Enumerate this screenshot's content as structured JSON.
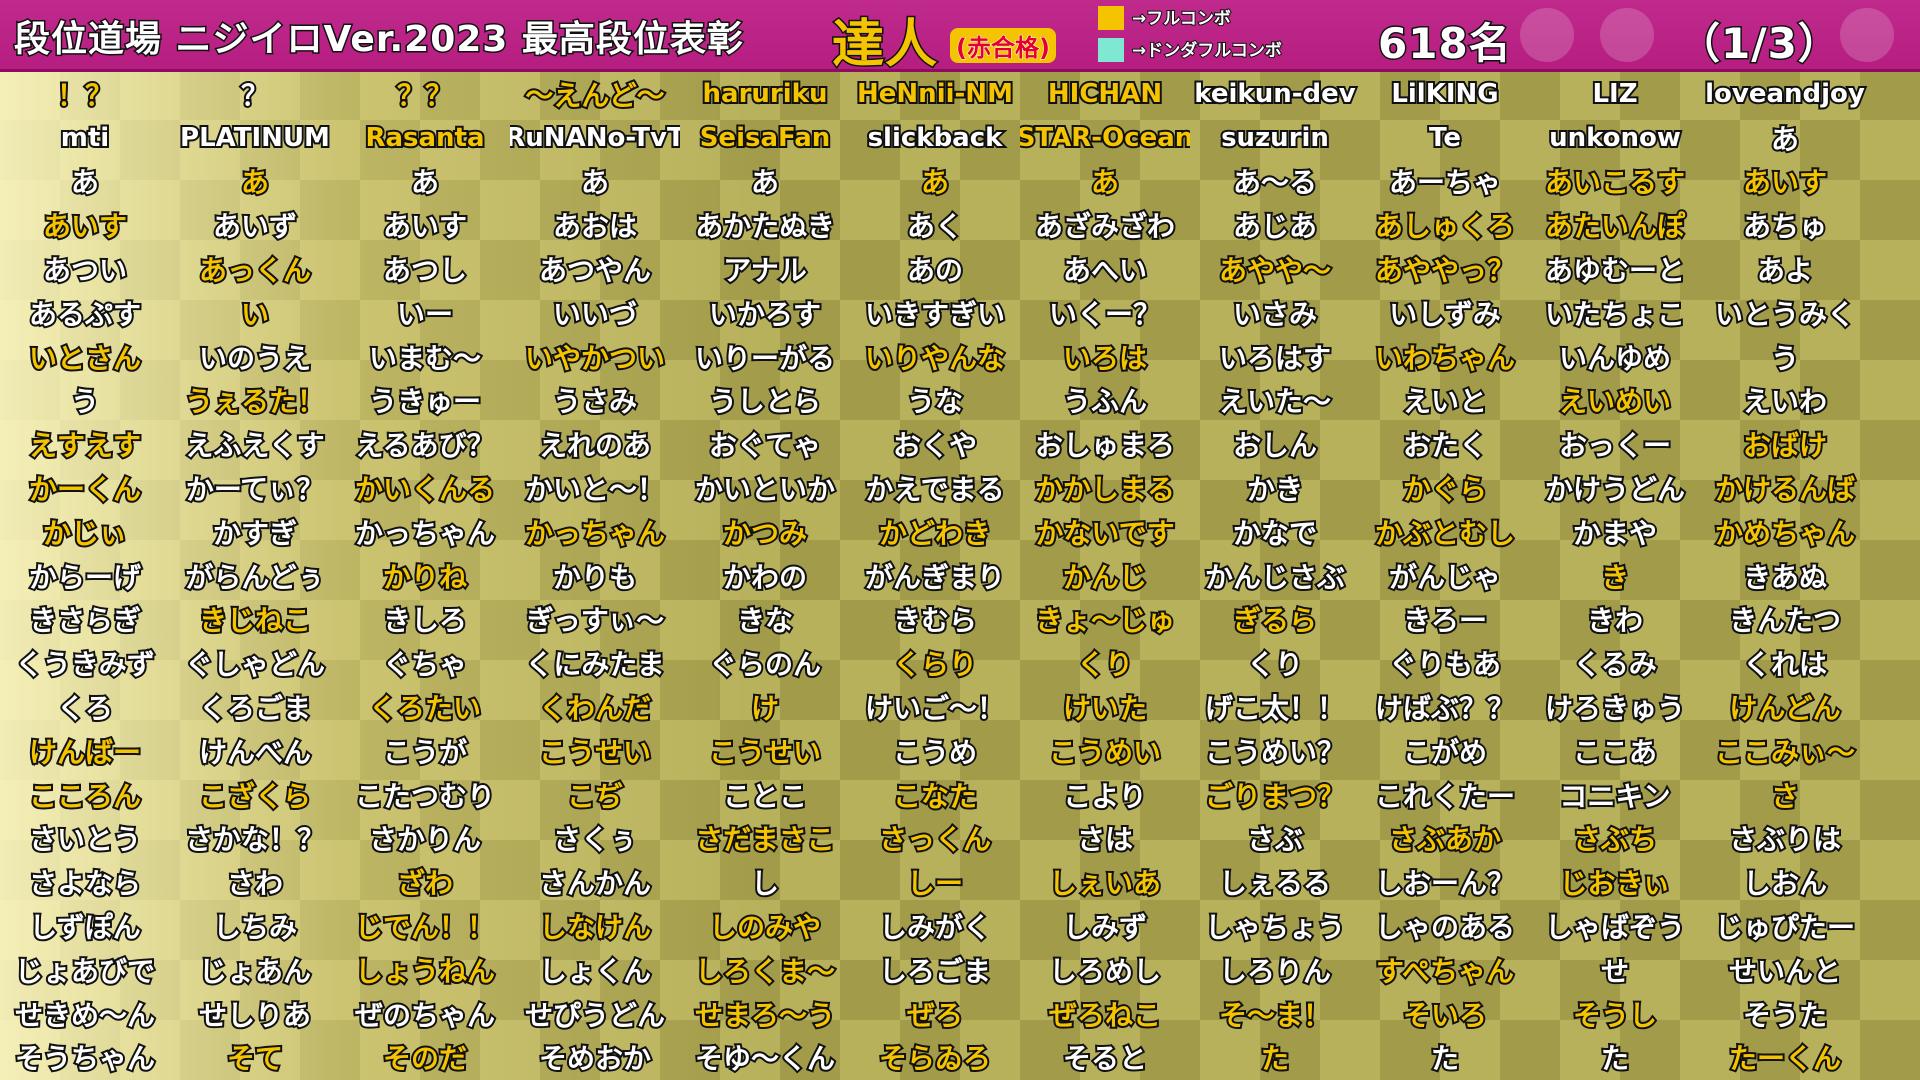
{
  "header": {
    "title": "段位道場 ニジイロVer.2023 最高段位表彰",
    "rank": "達人",
    "rank_note": "(赤合格)",
    "legend": [
      {
        "label": "→フルコンボ",
        "color": "#f5c400"
      },
      {
        "label": "→ドンダフルコンボ",
        "color": "#7ee8d2"
      }
    ],
    "count": "618名",
    "page": "（1/3）"
  },
  "rows": [
    [
      "！？",
      "？",
      "？？",
      "～えんど～",
      "haruriku",
      "HeNnii-NM",
      "HICHAN",
      "keikun-dev",
      "LilKING",
      "LIZ",
      "loveandjoy"
    ],
    [
      "mti",
      "PLATINUM",
      "Rasanta",
      "RuNANo-TvT",
      "SeisaFan",
      "slickback",
      "STAR-Ocean",
      "suzurin",
      "Te",
      "unkonow",
      "あ"
    ],
    [
      "あ",
      "あ",
      "あ",
      "あ",
      "あ",
      "あ",
      "あ",
      "あ～る",
      "あーちゃ",
      "あいこるす",
      "あいす"
    ],
    [
      "あいす",
      "あいず",
      "あいす",
      "あおは",
      "あかたぬき",
      "あく",
      "あざみざわ",
      "あじあ",
      "あしゅくろ",
      "あたいんぽ",
      "あちゅ"
    ],
    [
      "あつい",
      "あっくん",
      "あつし",
      "あつやん",
      "アナル",
      "あの",
      "あへい",
      "あやや～",
      "あややっ？",
      "あゆむーと",
      "あよ"
    ],
    [
      "あるぷす",
      "い",
      "いー",
      "いいづ",
      "いかろす",
      "いきすぎい",
      "いくー？",
      "いさみ",
      "いしずみ",
      "いたちょこ",
      "いとうみく"
    ],
    [
      "いとさん",
      "いのうえ",
      "いまむ～",
      "いやかつい",
      "いりーがる",
      "いりやんな",
      "いろは",
      "いろはす",
      "いわちゃん",
      "いんゆめ",
      "う"
    ],
    [
      "う",
      "うぇるた！",
      "うきゅー",
      "うさみ",
      "うしとら",
      "うな",
      "うふん",
      "えいた～",
      "えいと",
      "えいめい",
      "えいわ"
    ],
    [
      "えすえす",
      "えふえくす",
      "えるあび？",
      "えれのあ",
      "おぐてゃ",
      "おくや",
      "おしゅまろ",
      "おしん",
      "おたく",
      "おっくー",
      "おばけ"
    ],
    [
      "かーくん",
      "かーてぃ？",
      "かいくんる",
      "かいと～！",
      "かいといか",
      "かえでまる",
      "かかしまる",
      "かき",
      "かぐら",
      "かけうどん",
      "かけるんば"
    ],
    [
      "かじぃ",
      "かすぎ",
      "かっちゃん",
      "かっちゃん",
      "かつみ",
      "かどわき",
      "かないです",
      "かなで",
      "かぶとむし",
      "かまや",
      "かめちゃん"
    ],
    [
      "からーげ",
      "がらんどぅ",
      "かりね",
      "かりも",
      "かわの",
      "がんぎまり",
      "かんじ",
      "かんじさぶ",
      "がんじゃ",
      "き",
      "きあぬ"
    ],
    [
      "きさらぎ",
      "きじねこ",
      "きしろ",
      "ぎっすぃ～",
      "きな",
      "きむら",
      "きょ～じゅ",
      "ぎるら",
      "きろー",
      "きわ",
      "きんたつ"
    ],
    [
      "くうきみず",
      "ぐしゃどん",
      "ぐちゃ",
      "くにみたま",
      "ぐらのん",
      "くらり",
      "くり",
      "くり",
      "ぐりもあ",
      "くるみ",
      "くれは"
    ],
    [
      "くろ",
      "くろごま",
      "くろたい",
      "くわんだ",
      "け",
      "けいご～！",
      "けいた",
      "げこ太！！",
      "けばぶ？？",
      "けろきゅう",
      "けんどん"
    ],
    [
      "けんばー",
      "けんべん",
      "こうが",
      "こうせい",
      "こうせい",
      "こうめ",
      "こうめい",
      "こうめい？",
      "こがめ",
      "ここあ",
      "ここみぃ～"
    ],
    [
      "こころん",
      "こざくら",
      "こたつむり",
      "こぢ",
      "ことこ",
      "こなた",
      "こより",
      "ごりまつ？",
      "これくたー",
      "コニキン",
      "さ"
    ],
    [
      "さいとう",
      "さかな！？",
      "さかりん",
      "さくぅ",
      "さだまさこ",
      "さっくん",
      "さは",
      "さぶ",
      "さぶあか",
      "さぶち",
      "さぶりは"
    ],
    [
      "さよなら",
      "さわ",
      "ざわ",
      "さんかん",
      "し",
      "しー",
      "しぇいあ",
      "しぇるる",
      "しおーん？",
      "じおきぃ",
      "しおん"
    ],
    [
      "しずぽん",
      "しちみ",
      "じでん！！",
      "しなけん",
      "しのみや",
      "しみがく",
      "しみず",
      "しゃちょう",
      "しゃのある",
      "しゃばぞう",
      "じゅぴたー"
    ],
    [
      "じょあびで",
      "じょあん",
      "しょうねん",
      "しょくん",
      "しろくま～",
      "しろごま",
      "しろめし",
      "しろりん",
      "すぺちゃん",
      "せ",
      "せいんと"
    ],
    [
      "せきめ～ん",
      "せしりあ",
      "ぜのちゃん",
      "せぴうどん",
      "せまろ～う",
      "ぜろ",
      "ぜろねこ",
      "そ～ま！",
      "そいろ",
      "そうし",
      "そうた"
    ],
    [
      "そうちゃん",
      "そて",
      "そのだ",
      "そめおか",
      "そゆ～くん",
      "そらゐろ",
      "そると",
      "た",
      "た",
      "た",
      "たーくん"
    ]
  ],
  "gold_cells": [
    "0-0",
    "0-2",
    "0-3",
    "0-4",
    "0-5",
    "0-6",
    "1-2",
    "1-4",
    "1-6",
    "2-1",
    "2-5",
    "2-6",
    "2-9",
    "2-10",
    "3-0",
    "3-8",
    "3-9",
    "4-1",
    "4-7",
    "4-8",
    "5-1",
    "6-0",
    "6-3",
    "6-5",
    "6-6",
    "6-8",
    "7-1",
    "7-9",
    "8-0",
    "8-10",
    "9-0",
    "9-2",
    "9-6",
    "9-8",
    "9-10",
    "10-0",
    "10-3",
    "10-4",
    "10-5",
    "10-6",
    "10-8",
    "10-10",
    "11-2",
    "11-6",
    "11-9",
    "12-1",
    "12-6",
    "12-7",
    "13-5",
    "13-6",
    "14-2",
    "14-3",
    "14-4",
    "14-6",
    "14-10",
    "15-0",
    "15-3",
    "15-4",
    "15-6",
    "15-10",
    "16-0",
    "16-1",
    "16-3",
    "16-5",
    "16-7",
    "16-10",
    "17-4",
    "17-5",
    "17-8",
    "17-9",
    "18-2",
    "18-5",
    "18-6",
    "18-9",
    "19-2",
    "19-3",
    "19-4",
    "20-2",
    "20-4",
    "20-8",
    "21-4",
    "21-5",
    "21-6",
    "21-7",
    "21-8",
    "21-9",
    "22-1",
    "22-2",
    "22-5",
    "22-7",
    "22-10"
  ]
}
